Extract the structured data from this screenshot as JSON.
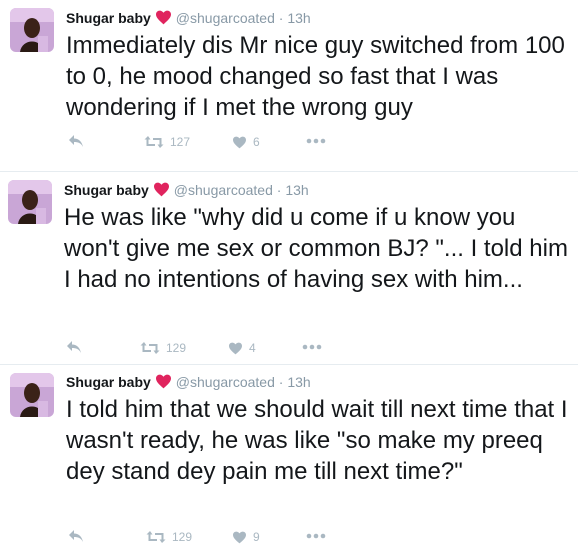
{
  "colors": {
    "name": "#14171a",
    "meta": "#8899a6",
    "action": "#aab8c2",
    "heart": "#e0245e",
    "divider": "#e6ecf0"
  },
  "tweets": [
    {
      "name": "Shugar baby",
      "badge_icon": "red-heart-icon",
      "handle": "@shugarcoated",
      "separator": "·",
      "time": "13h",
      "text": "Immediately dis Mr nice guy switched from 100 to 0, he mood changed so fast that I was wondering if I met the wrong guy",
      "retweets": "127",
      "likes": "6"
    },
    {
      "name": "Shugar baby",
      "badge_icon": "red-heart-icon",
      "handle": "@shugarcoated",
      "separator": "·",
      "time": "13h",
      "text": "He was like \"why did u come if u know you won't give me sex or common BJ? \"... I told him I had no intentions of having sex with him...",
      "retweets": "129",
      "likes": "4"
    },
    {
      "name": "Shugar baby",
      "badge_icon": "red-heart-icon",
      "handle": "@shugarcoated",
      "separator": "·",
      "time": "13h",
      "text": "I told him that we should wait till next time that I wasn't ready, he was like \"so make my preeq dey stand dey pain me till next time?\"",
      "retweets": "129",
      "likes": "9"
    }
  ]
}
